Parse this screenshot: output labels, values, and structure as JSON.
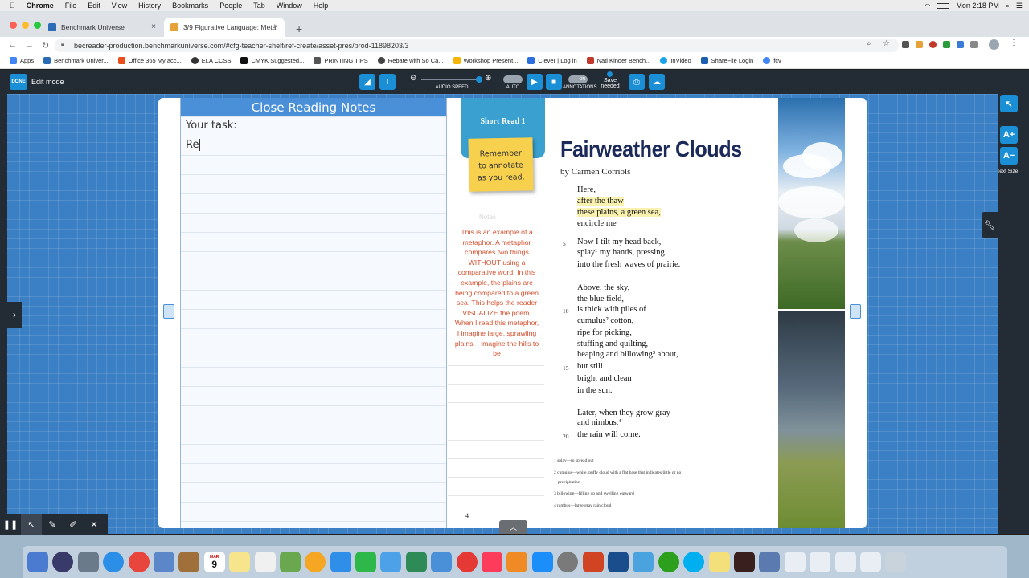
{
  "menubar": {
    "apple": "",
    "items": [
      "Chrome",
      "File",
      "Edit",
      "View",
      "History",
      "Bookmarks",
      "People",
      "Tab",
      "Window",
      "Help"
    ],
    "clock": "Mon 2:18 PM"
  },
  "tabs": [
    {
      "title": "Benchmark Universe",
      "close": "×",
      "color": "#2c6bb5"
    },
    {
      "title": "3/9 Figurative Language: Meta",
      "close": "×",
      "color": "#e8a23a"
    }
  ],
  "new_tab": "+",
  "address": {
    "url": "becreader-production.benchmarkuniverse.com/#cfg-teacher-shelf/ref-create/asset-pres/prod-11898203/3"
  },
  "bookmarks": [
    {
      "label": "Apps",
      "color": "#4285f4"
    },
    {
      "label": "Benchmark Univer...",
      "color": "#2c6bb5"
    },
    {
      "label": "Office 365 My acc...",
      "color": "#e94e1b"
    },
    {
      "label": "ELA CCSS",
      "color": "#333333"
    },
    {
      "label": "CMYK Suggested...",
      "color": "#111111"
    },
    {
      "label": "PRINTING TIPS",
      "color": "#555555"
    },
    {
      "label": "Rebate with So Ca...",
      "color": "#444444"
    },
    {
      "label": "Workshop Present...",
      "color": "#f4b400"
    },
    {
      "label": "Clever | Log in",
      "color": "#2a6fdb"
    },
    {
      "label": "Natl Kinder Bench...",
      "color": "#c0392b"
    },
    {
      "label": "InVideo",
      "color": "#1aa3e8"
    },
    {
      "label": "ShareFile Login",
      "color": "#1c5fb0"
    },
    {
      "label": "fcv",
      "color": "#4285f4"
    }
  ],
  "toolbar": {
    "done": "DONE",
    "edit_mode": "Edit mode",
    "audio_speed": "AUDIO SPEED",
    "auto": "AUTO",
    "annotations": "ANNOTATIONS",
    "save_needed": "Save needed",
    "on": "ON"
  },
  "notes": {
    "header": "Close Reading Notes",
    "line1": "Your task:",
    "line2": "Re"
  },
  "short_read": {
    "title": "Short Read 1",
    "sticky": [
      "Remember",
      "to annotate",
      "as you read."
    ]
  },
  "gutter": {
    "notes_label": "Notes",
    "annotation": "This is an example of a metaphor. A metaphor compares two things WITHOUT using a comparative word. In this example, the plains are being compared to a green sea. This helps the reader VISUALIZE the poem. When I read this metaphor, I imagine large, sprawling plains. I imagine the hills to be"
  },
  "poem": {
    "title": "Fairweather Clouds",
    "author": "by Carmen Corriols",
    "lines": [
      "Here,",
      "after the thaw",
      "these plains, a green sea,",
      "encircle me",
      "Now I tilt my head back,",
      "splay¹ my hands, pressing",
      "into the fresh waves of prairie.",
      "Above, the sky,",
      "the blue field,",
      "is thick with piles of",
      "cumulus² cotton,",
      "ripe for picking,",
      "stuffing and quilting,",
      "heaping and billowing³ about,",
      "but still",
      "bright and clean",
      "in the sun.",
      "Later, when they grow gray",
      "and nimbus,⁴",
      "the rain will come."
    ],
    "line_numbers": [
      "5",
      "10",
      "15",
      "20"
    ],
    "footnotes": [
      "1 splay—to spread out",
      "2 cumulus—white, puffy cloud with a flat base that indicates little or no",
      "precipitation",
      "3 billowing—filling up and swelling outward",
      "4 nimbus—large gray rain cloud"
    ],
    "page_number": "4"
  },
  "right_tools": {
    "increase": "A+",
    "decrease": "A−",
    "label": "Text Size"
  },
  "dock": {
    "calendar_month": "MAR",
    "calendar_day": "9"
  }
}
